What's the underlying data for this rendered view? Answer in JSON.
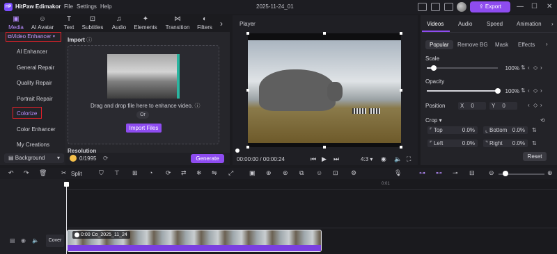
{
  "window": {
    "app_title": "HitPaw Edimakor",
    "menu": [
      "File",
      "Settings",
      "Help"
    ],
    "project_title": "2025-11-24_01",
    "export_label": "Export",
    "controls": [
      "—",
      "☐",
      "✕"
    ]
  },
  "toolbar": {
    "tabs": [
      {
        "label": "Media",
        "icon": "media-icon",
        "glyph": "▣"
      },
      {
        "label": "AI Avatar",
        "icon": "ai-avatar-icon",
        "glyph": "☺"
      },
      {
        "label": "Text",
        "icon": "text-icon",
        "glyph": "T"
      },
      {
        "label": "Subtitles",
        "icon": "subtitles-icon",
        "glyph": "⊡"
      },
      {
        "label": "Audio",
        "icon": "audio-icon",
        "glyph": "♫"
      },
      {
        "label": "Elements",
        "icon": "elements-icon",
        "glyph": "✦"
      },
      {
        "label": "Transition",
        "icon": "transition-icon",
        "glyph": "⋈"
      },
      {
        "label": "Filters",
        "icon": "filters-icon",
        "glyph": "◐"
      }
    ],
    "more_glyph": "›"
  },
  "sidebar": {
    "dropdown_label": "Video Enhancer",
    "items": [
      "AI Enhancer",
      "General Repair",
      "Quality Repair",
      "Portrait Repair",
      "Colorize",
      "Color Enhancer",
      "My Creations"
    ],
    "selected_item": "Colorize",
    "background_label": "Background"
  },
  "import_panel": {
    "title": "Import",
    "drop_text": "Drag and drop file here to enhance video.",
    "or_text": "Or",
    "import_button": "Import Files",
    "resolution_label": "Resolution",
    "credits": "0/1995",
    "generate_button": "Generate"
  },
  "player": {
    "title": "Player",
    "time": "00:00:00 / 00:00:24",
    "aspect": "4:3"
  },
  "properties": {
    "tabs": [
      "Videos",
      "Audio",
      "Speed",
      "Animation"
    ],
    "active_tab": "Videos",
    "subtabs": [
      "Popular",
      "Remove BG",
      "Mask",
      "Effects"
    ],
    "active_subtab": "Popular",
    "scale_label": "Scale",
    "scale_value": "100%",
    "scale_fraction": 0.1,
    "opacity_label": "Opacity",
    "opacity_value": "100%",
    "opacity_fraction": 1.0,
    "position_label": "Position",
    "pos_x_label": "X",
    "pos_x_value": "0",
    "pos_y_label": "Y",
    "pos_y_value": "0",
    "crop_label": "Crop",
    "crop_top_label": "Top",
    "crop_top_value": "0.0%",
    "crop_bottom_label": "Bottom",
    "crop_bottom_value": "0.0%",
    "crop_left_label": "Left",
    "crop_left_value": "0.0%",
    "crop_right_label": "Right",
    "crop_right_value": "0.0%",
    "reset_label": "Reset"
  },
  "timeline": {
    "split_label": "Split",
    "ruler_tick": "0:01",
    "cover_label": "Cover",
    "clip_label": "0:00  Co_2025_11_24"
  },
  "colors": {
    "accent": "#8e4cf0",
    "highlight_box": "#e8212a",
    "active_tab_text": "#b88cff"
  }
}
